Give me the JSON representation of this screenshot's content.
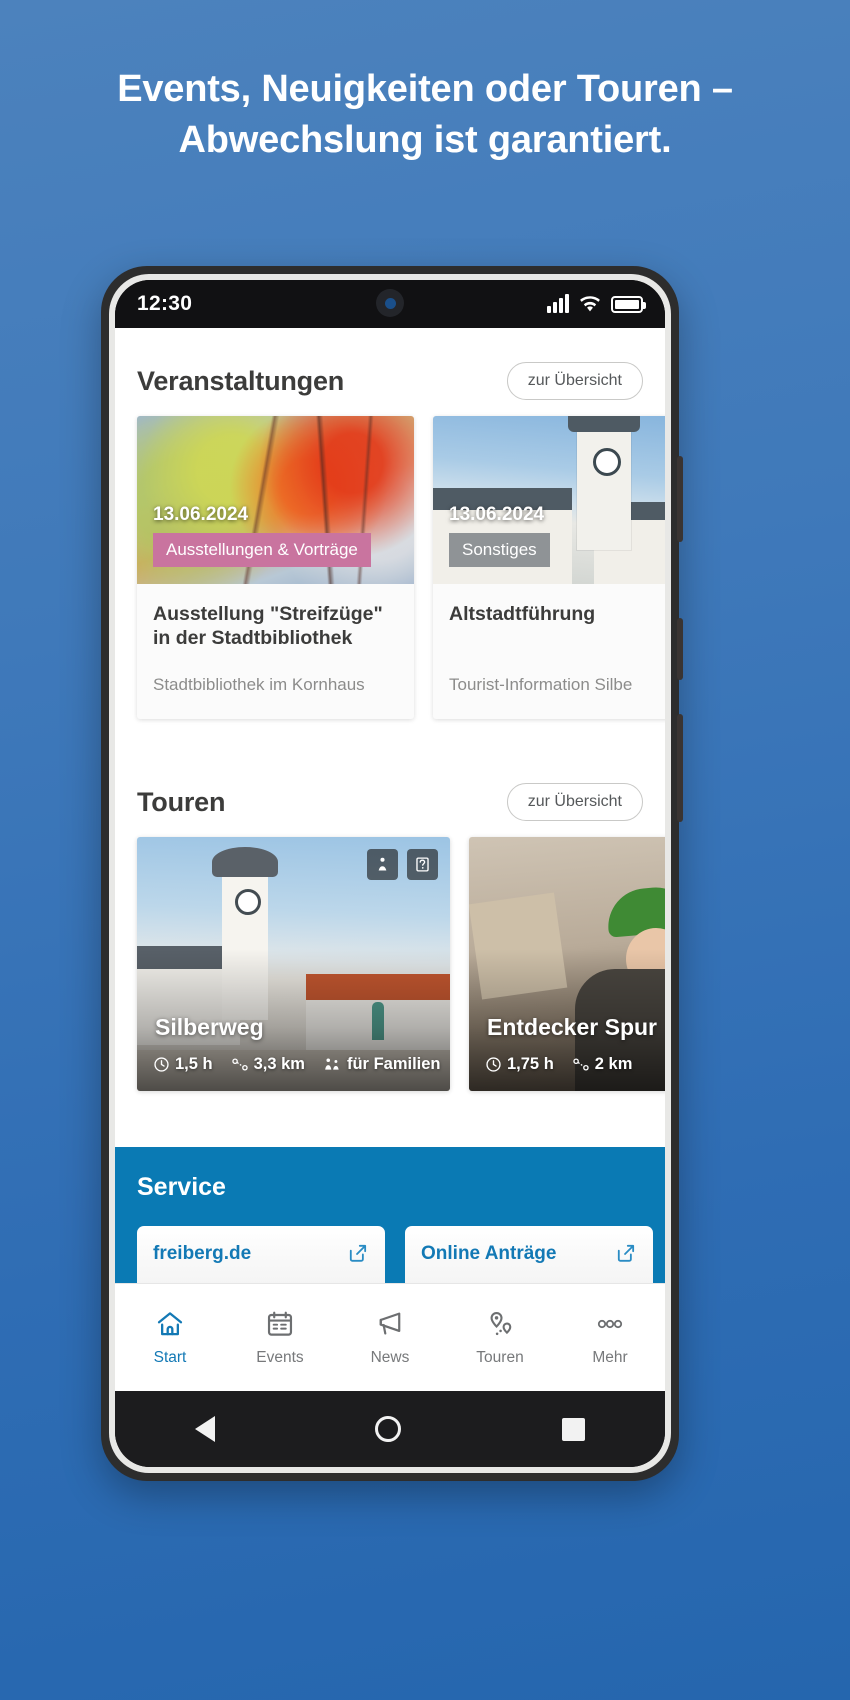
{
  "promo": {
    "headline": "Events, Neuigkeiten oder Touren – Abwechslung ist garantiert.",
    "background_color": "#3f79ba"
  },
  "status_bar": {
    "time": "12:30",
    "signal_icon": "cellular-signal-icon",
    "wifi_icon": "wifi-icon",
    "battery_icon": "battery-full-icon"
  },
  "app": {
    "accent_color": "#1379b5",
    "sections": {
      "events": {
        "title": "Veranstaltungen",
        "overview_label": "zur Übersicht",
        "cards": [
          {
            "date": "13.06.2024",
            "category": "Ausstellungen & Vorträge",
            "category_color": "#c9749f",
            "title": "Ausstellung \"Streifzüge\" in der Stadtbibliothek",
            "location": "Stadtbibliothek im Kornhaus"
          },
          {
            "date": "13.06.2024",
            "category": "Sonstiges",
            "category_color": "#8f9396",
            "title": "Altstadtführung",
            "location": "Tourist-Information Silbe"
          }
        ]
      },
      "tours": {
        "title": "Touren",
        "overview_label": "zur Übersicht",
        "cards": [
          {
            "name": "Silberweg",
            "duration": "1,5 h",
            "distance": "3,3 km",
            "audience": "für Familien",
            "badges": [
              "person-walking-icon",
              "audio-guide-icon"
            ]
          },
          {
            "name": "Entdecker Spur",
            "duration": "1,75 h",
            "distance": "2 km",
            "audience": "",
            "badges": []
          }
        ]
      },
      "service": {
        "title": "Service",
        "tiles": [
          {
            "label": "freiberg.de",
            "icon": "external-link-icon"
          },
          {
            "label": "Online Anträge",
            "icon": "external-link-icon"
          }
        ]
      }
    },
    "tabbar": [
      {
        "label": "Start",
        "icon": "home-icon",
        "active": true
      },
      {
        "label": "Events",
        "icon": "calendar-icon",
        "active": false
      },
      {
        "label": "News",
        "icon": "megaphone-icon",
        "active": false
      },
      {
        "label": "Touren",
        "icon": "map-pins-icon",
        "active": false
      },
      {
        "label": "Mehr",
        "icon": "more-dots-icon",
        "active": false
      }
    ]
  },
  "android_nav": {
    "back": "back-triangle-icon",
    "home": "home-circle-icon",
    "recents": "recents-square-icon"
  }
}
